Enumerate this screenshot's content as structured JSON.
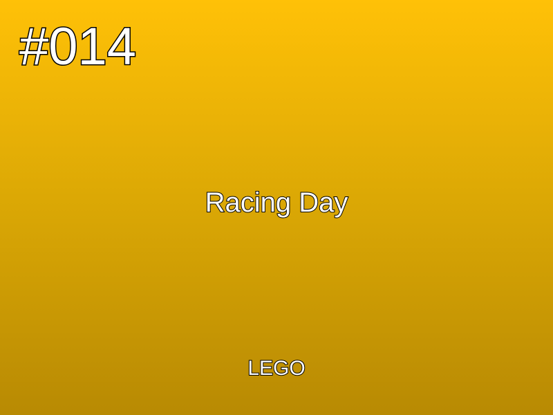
{
  "card": {
    "number": "#014",
    "title": "Racing Day",
    "brand": "LEGO"
  },
  "colors": {
    "gradient_top": "#FFC107",
    "gradient_bottom": "#B88A03",
    "text_fill": "#FFFFFF",
    "text_outline": "#000000"
  }
}
